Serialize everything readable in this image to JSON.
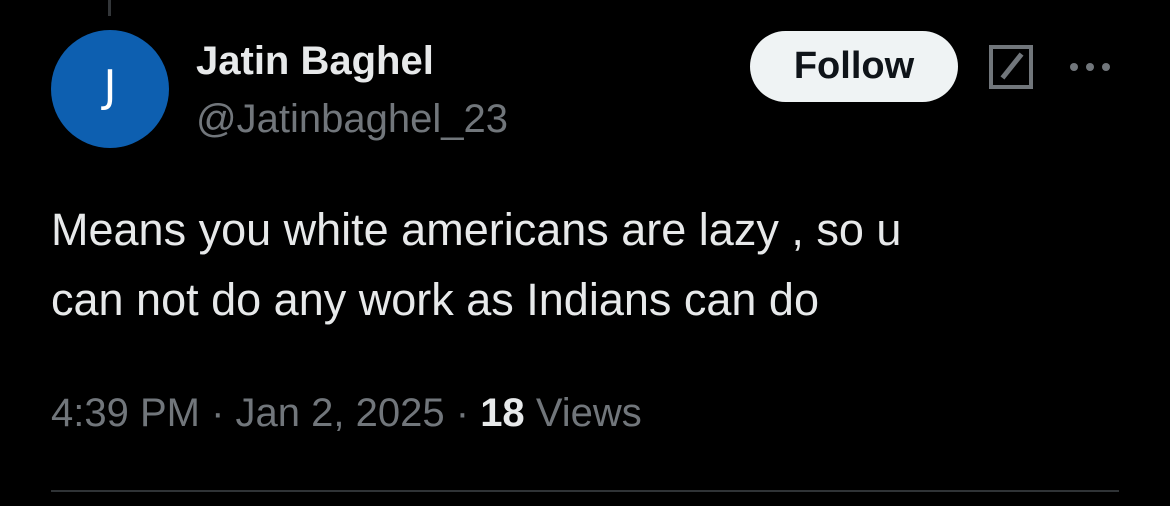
{
  "author": {
    "avatar_initial": "J",
    "display_name": "Jatin Baghel",
    "handle": "@Jatinbaghel_23"
  },
  "actions": {
    "follow_label": "Follow",
    "grok_icon": "grok-icon",
    "more_icon": "more-icon"
  },
  "tweet": {
    "text_line1": "Means you white americans are lazy , so u",
    "text_line2": "can not do any work as Indians can do",
    "time": "4:39 PM",
    "separator": "·",
    "date": "Jan 2, 2025",
    "views_count": "18",
    "views_label": "Views"
  },
  "colors": {
    "background": "#000000",
    "avatar": "#0d5fb0",
    "primary_text": "#e7e9ea",
    "secondary_text": "#71767b",
    "follow_bg": "#eff3f4"
  }
}
